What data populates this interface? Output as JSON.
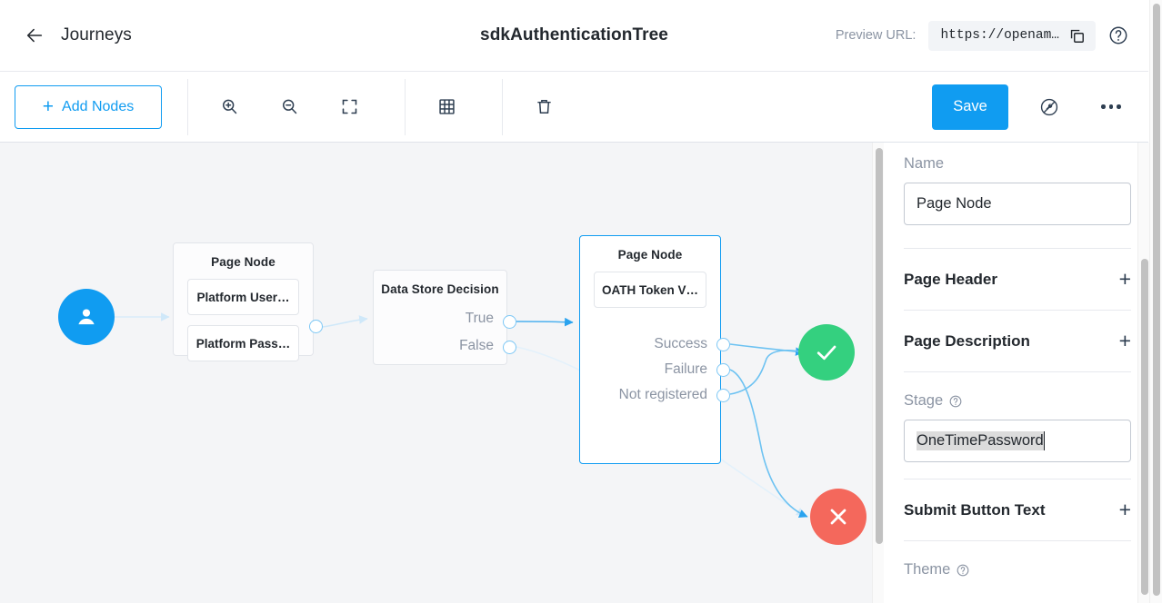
{
  "header": {
    "back_icon": "arrow-left-icon",
    "breadcrumb": "Journeys",
    "title": "sdkAuthenticationTree",
    "preview_label": "Preview URL:",
    "preview_url": "https://openam…",
    "copy_icon": "copy-icon",
    "help_icon": "help-circle-icon"
  },
  "toolbar": {
    "add_nodes_label": "Add Nodes",
    "add_nodes_plus": "+",
    "zoom_in_icon": "zoom-in-icon",
    "zoom_out_icon": "zoom-out-icon",
    "fit_screen_icon": "fit-to-screen-icon",
    "grid_icon": "grid-icon",
    "delete_icon": "trash-icon",
    "save_label": "Save",
    "tools_icon": "wrench-disabled-icon",
    "more_icon": "more-horizontal-icon"
  },
  "canvas": {
    "start_node": {
      "icon": "user-icon"
    },
    "nodes": [
      {
        "title": "Page Node",
        "chips": [
          "Platform User…",
          "Platform Pass…"
        ],
        "outputs": [],
        "selected": false
      },
      {
        "title": "Data Store Decision",
        "chips": [],
        "outputs": [
          "True",
          "False"
        ],
        "selected": false
      },
      {
        "title": "Page Node",
        "chips": [
          "OATH Token V…"
        ],
        "outputs": [
          "Success",
          "Failure",
          "Not registered"
        ],
        "selected": true
      }
    ],
    "success_node": {
      "icon": "check-icon"
    },
    "failure_node": {
      "icon": "close-icon"
    },
    "colors": {
      "accent": "#109cf1",
      "success": "#34d07f",
      "failure": "#f4685c",
      "canvas_bg": "#f4f5f7",
      "link": "#64bdf0"
    }
  },
  "panel": {
    "name_label": "Name",
    "name_value": "Page Node",
    "sections": [
      {
        "title": "Page Header",
        "add": "+"
      },
      {
        "title": "Page Description",
        "add": "+"
      }
    ],
    "stage_label": "Stage",
    "stage_help_icon": "help-circle-icon",
    "stage_value": "OneTimePassword",
    "submit_section": {
      "title": "Submit Button Text",
      "add": "+"
    },
    "theme_label": "Theme",
    "theme_help_icon": "help-circle-icon"
  }
}
